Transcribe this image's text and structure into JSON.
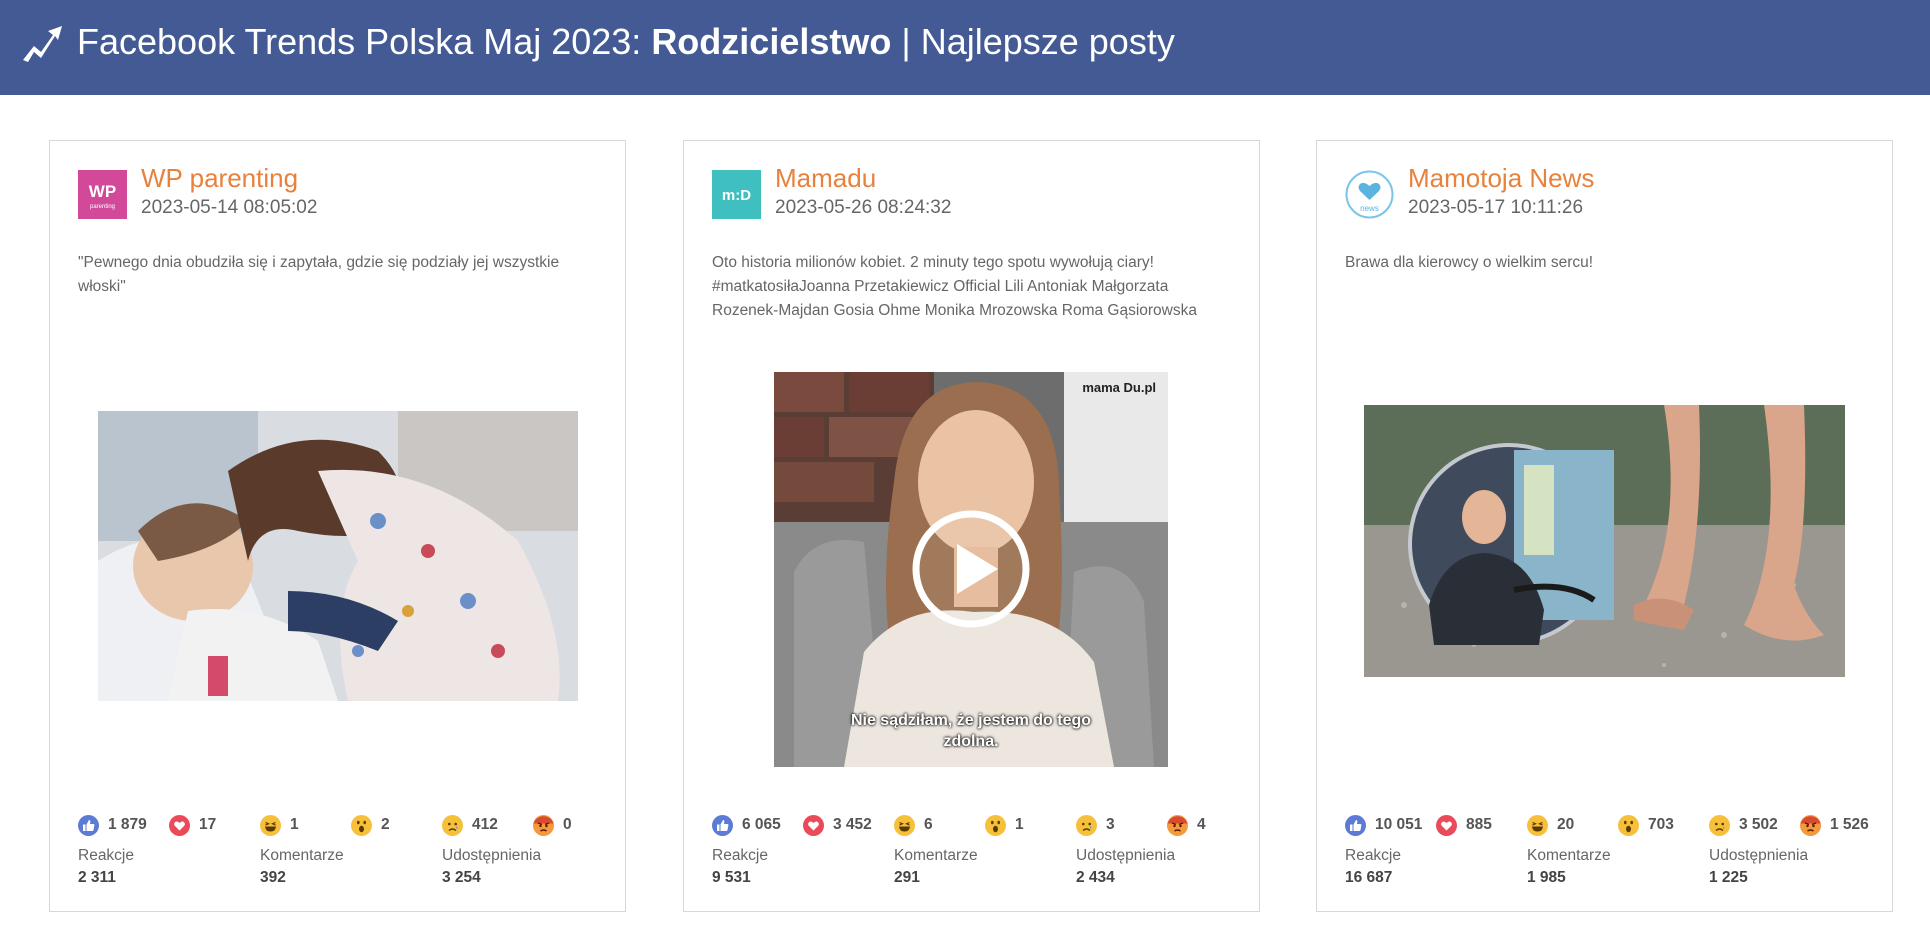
{
  "header": {
    "title_prefix": "Facebook Trends Polska Maj 2023: ",
    "title_bold": "Rodzicielstwo",
    "title_suffix": " | Najlepsze posty"
  },
  "colors": {
    "header_bg": "#435a94",
    "name": "#e8813c"
  },
  "metric_labels": {
    "reactions": "Reakcje",
    "comments": "Komentarze",
    "shares": "Udostępnienia"
  },
  "cards": [
    {
      "name": "WP parenting",
      "date": "2023-05-14 08:05:02",
      "text": "\"Pewnego dnia obudziła się i zapytała, gdzie się podziały jej wszystkie włoski\"",
      "avatar_text": "WP",
      "avatar_sub": "parenting",
      "reactions": {
        "like": "1 879",
        "love": "17",
        "haha": "1",
        "wow": "2",
        "sad": "412",
        "angry": "0"
      },
      "metrics": {
        "reactions": "2 311",
        "comments": "392",
        "shares": "3 254"
      }
    },
    {
      "name": "Mamadu",
      "date": "2023-05-26 08:24:32",
      "text": "Oto historia milionów kobiet. 2 minuty tego spotu wywołują ciary! #matkatosiłaJoanna Przetakiewicz Official Lili Antoniak Małgorzata Rozenek-Majdan Gosia Ohme Monika Mrozowska Roma Gąsiorowska",
      "avatar_text": "m:D",
      "video_watermark": "mama Du.pl",
      "video_caption_1": "Nie sądziłam, że jestem do tego",
      "video_caption_2": "zdolna.",
      "reactions": {
        "like": "6 065",
        "love": "3 452",
        "haha": "6",
        "wow": "1",
        "sad": "3",
        "angry": "4"
      },
      "metrics": {
        "reactions": "9 531",
        "comments": "291",
        "shares": "2 434"
      }
    },
    {
      "name": "Mamotoja News",
      "date": "2023-05-17 10:11:26",
      "text": "Brawa dla kierowcy o wielkim sercu!",
      "avatar_text": "news",
      "reactions": {
        "like": "10 051",
        "love": "885",
        "haha": "20",
        "wow": "703",
        "sad": "3 502",
        "angry": "1 526"
      },
      "metrics": {
        "reactions": "16 687",
        "comments": "1 985",
        "shares": "1 225"
      }
    }
  ]
}
